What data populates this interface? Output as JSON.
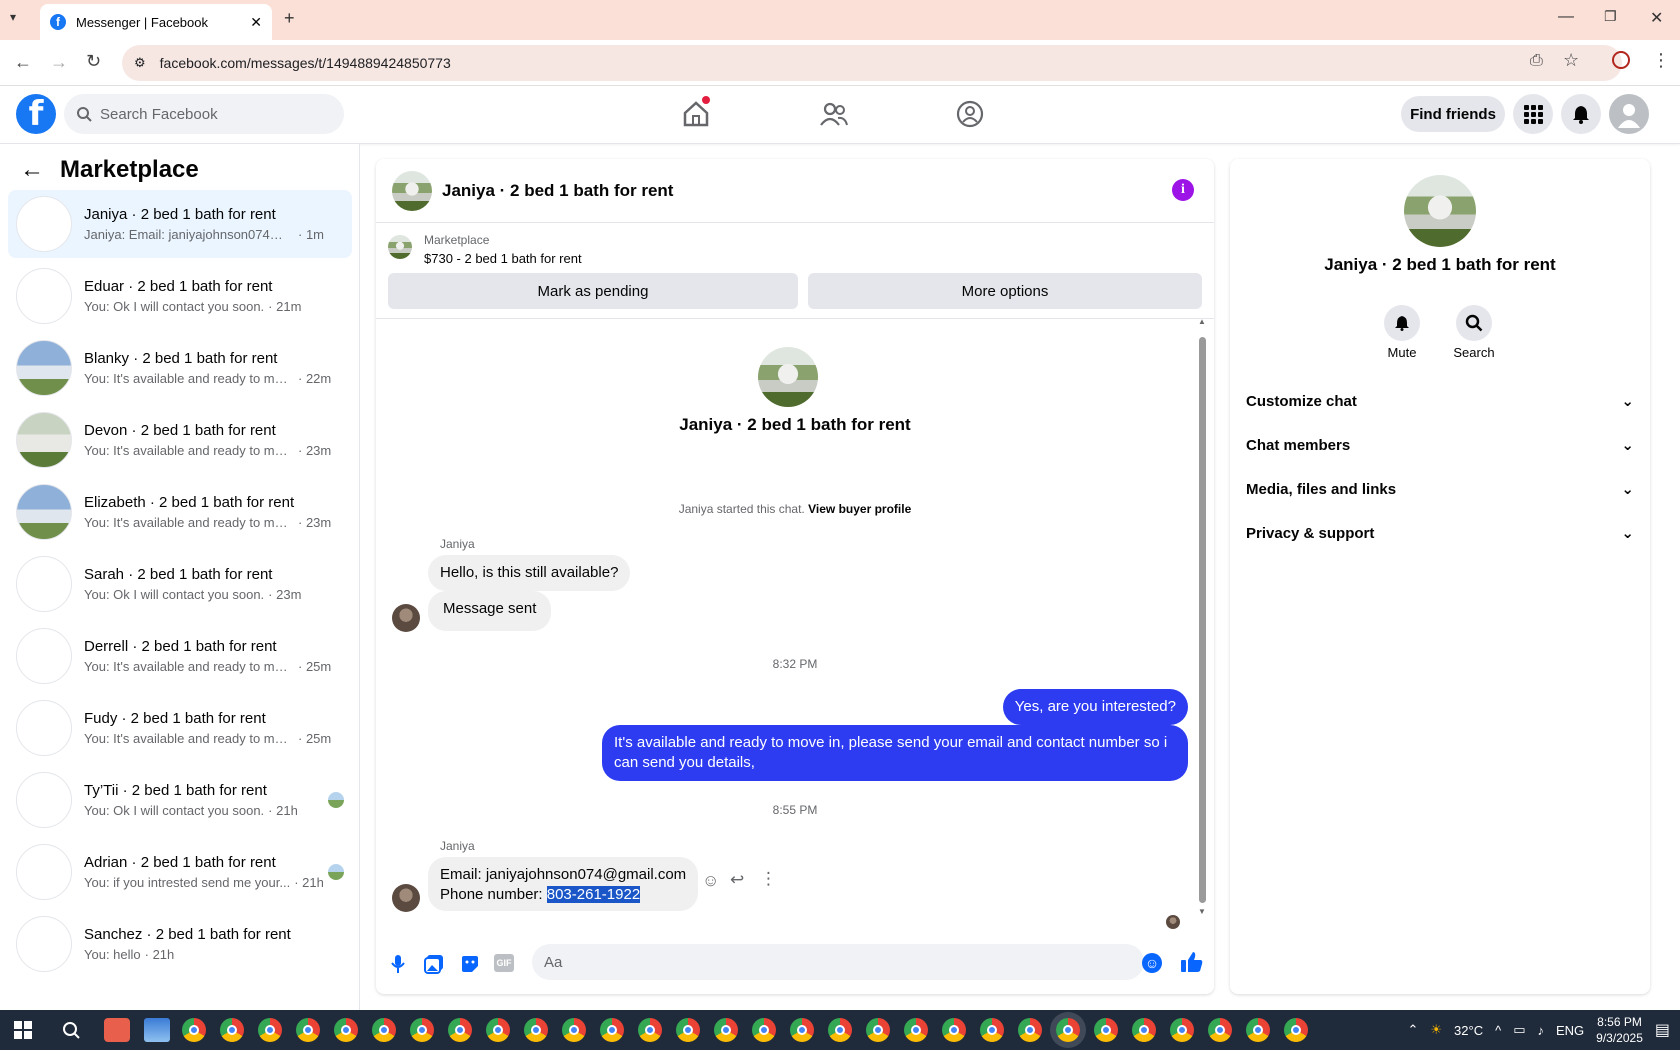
{
  "browser": {
    "tab_title": "Messenger | Facebook",
    "url": "facebook.com/messages/t/1494889424850773"
  },
  "header": {
    "search_placeholder": "Search Facebook",
    "find_friends": "Find friends"
  },
  "sidebar": {
    "title": "Marketplace",
    "conversations": [
      {
        "name": "Janiya · 2 bed 1 bath for rent",
        "preview": "Janiya: Email: janiyajohnson074@gm...",
        "time": "· 1m",
        "active": true
      },
      {
        "name": "Eduar · 2 bed 1 bath for rent",
        "preview": "You: Ok I will contact you soon.",
        "time": "· 21m"
      },
      {
        "name": "Blanky · 2 bed 1 bath for rent",
        "preview": "You: It's available and ready to mov...",
        "time": "· 22m"
      },
      {
        "name": "Devon · 2 bed 1 bath for rent",
        "preview": "You: It's available and ready to mov...",
        "time": "· 23m"
      },
      {
        "name": "Elizabeth · 2 bed 1 bath for rent",
        "preview": "You: It's available and ready to mov...",
        "time": "· 23m"
      },
      {
        "name": "Sarah · 2 bed 1 bath for rent",
        "preview": "You: Ok I will contact you soon.",
        "time": "· 23m"
      },
      {
        "name": "Derrell · 2 bed 1 bath for rent",
        "preview": "You: It's available and ready to mov...",
        "time": "· 25m"
      },
      {
        "name": "Fudy · 2 bed 1 bath for rent",
        "preview": "You: It's available and ready to mov...",
        "time": "· 25m"
      },
      {
        "name": "Ty’Tii · 2 bed 1 bath for rent",
        "preview": "You: Ok I will contact you soon.",
        "time": "· 21h"
      },
      {
        "name": "Adrian · 2 bed 1 bath for rent",
        "preview": "You: if you intrested send me your...",
        "time": "· 21h"
      },
      {
        "name": "Sanchez · 2 bed 1 bath for rent",
        "preview": "You: hello",
        "time": "· 21h"
      }
    ]
  },
  "chat": {
    "title": "Janiya · 2 bed 1 bath for rent",
    "listing_source": "Marketplace",
    "listing_title": "$730 - 2 bed 1 bath for rent",
    "mark_pending": "Mark as pending",
    "more_options": "More options",
    "profile_name": "Janiya · 2 bed 1 bath for rent",
    "started_text": "Janiya started this chat.",
    "view_buyer": "View buyer profile",
    "sender1": "Janiya",
    "msg1": "Hello, is this still available?",
    "msg2": "Message sent",
    "time1": "8:32 PM",
    "out1": "Yes, are you interested?",
    "out2": "It's available and ready to move in, please send your email and contact number so i can send you details,",
    "time2": "8:55 PM",
    "sender2": "Janiya",
    "email_line": "Email: janiyajohnson074@gmail.com",
    "phone_label": "Phone number: ",
    "phone_value": "803-261-1922",
    "composer_placeholder": "Aa"
  },
  "info": {
    "name": "Janiya · 2 bed 1 bath for rent",
    "mute": "Mute",
    "search": "Search",
    "sections": [
      "Customize chat",
      "Chat members",
      "Media, files and links",
      "Privacy & support"
    ]
  },
  "taskbar": {
    "weather": "32°C",
    "lang": "ENG",
    "time": "8:56 PM",
    "date": "9/3/2025"
  },
  "colors": {
    "accent": "#1877f2",
    "outgoing": "#2d3cf0",
    "info": "#9d15e6"
  }
}
